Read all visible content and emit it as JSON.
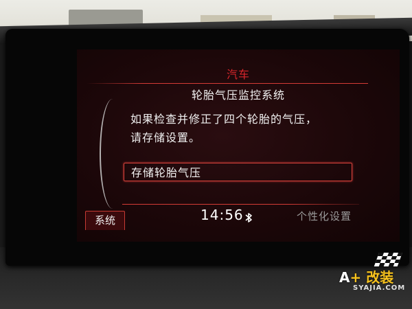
{
  "header": {
    "section_title": "汽车",
    "page_title": "轮胎气压监控系统"
  },
  "content": {
    "message_line1": "如果检查并修正了四个轮胎的气压，",
    "message_line2": "请存储设置。",
    "save_button_label": "存储轮胎气压"
  },
  "footer": {
    "left_tab_label": "系统",
    "clock": "14:56",
    "right_tab_label": "个性化设置"
  },
  "watermark": {
    "logo_a": "A",
    "logo_plus": "+",
    "logo_cn": "改装",
    "logo_url": "SYAJIA.COM"
  },
  "colors": {
    "accent_red": "#d63b36",
    "screen_bg": "#1c0709",
    "logo_yellow": "#f7c21e"
  },
  "icons": {
    "status": "bluetooth-icon",
    "logo": "checkered-flag-icon"
  }
}
